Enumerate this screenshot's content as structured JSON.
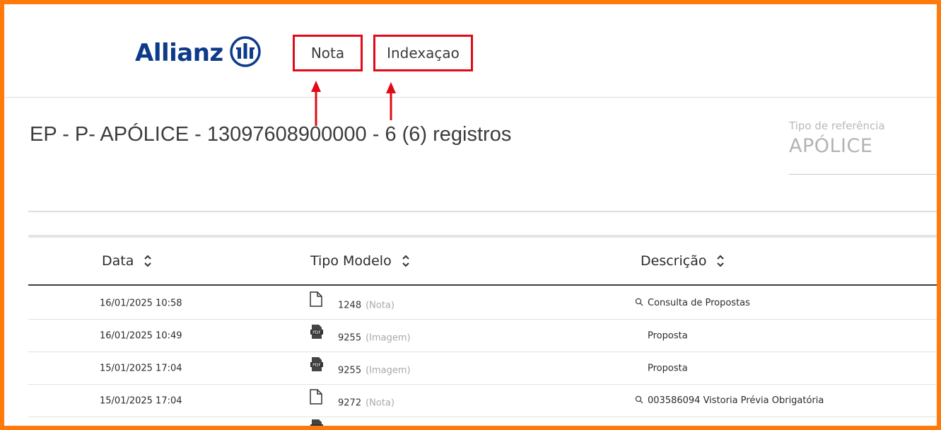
{
  "header": {
    "logo_text": "Allianz",
    "nav": [
      {
        "label": "Nota"
      },
      {
        "label": "Indexaçao"
      }
    ]
  },
  "page": {
    "title": "EP - P- APÓLICE - 13097608900000 - 6 (6) registros",
    "reference_label": "Tipo de referência",
    "reference_value": "APÓLICE"
  },
  "table": {
    "columns": [
      "Data",
      "Tipo Modelo",
      "Descrição"
    ],
    "rows": [
      {
        "date": "16/01/2025 10:58",
        "icon": "document-icon",
        "code": "1248",
        "kind": "(Nota)",
        "search": true,
        "description": "Consulta de Propostas"
      },
      {
        "date": "16/01/2025 10:49",
        "icon": "pdf-icon",
        "code": "9255",
        "kind": "(Imagem)",
        "search": false,
        "description": "Proposta"
      },
      {
        "date": "15/01/2025 17:04",
        "icon": "pdf-icon",
        "code": "9255",
        "kind": "(Imagem)",
        "search": false,
        "description": "Proposta"
      },
      {
        "date": "15/01/2025 17:04",
        "icon": "document-icon",
        "code": "9272",
        "kind": "(Nota)",
        "search": true,
        "description": "003586094 Vistoria Prévia Obrigatória"
      }
    ]
  },
  "colors": {
    "frame": "#ff7a0a",
    "highlight": "#e00b16",
    "brand": "#0d3a8a"
  }
}
